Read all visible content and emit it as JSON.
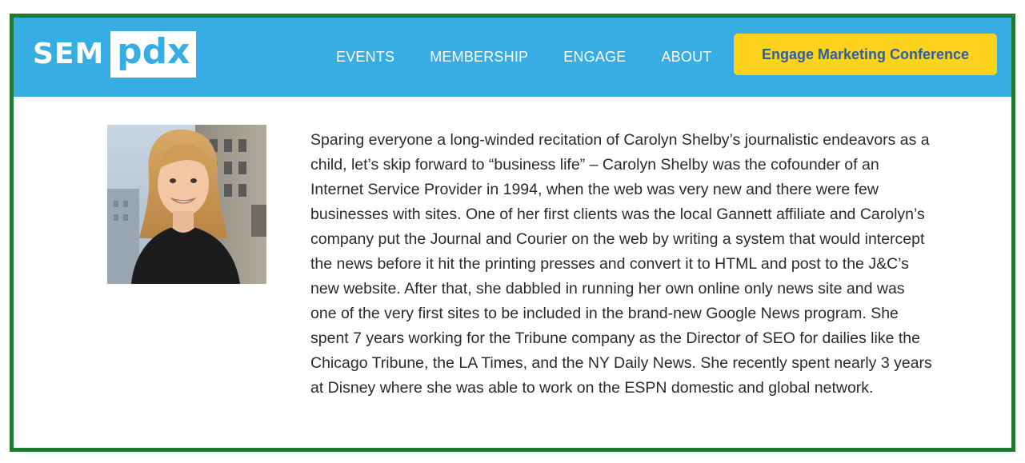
{
  "logo": {
    "sem": "SEM",
    "pdx": "pdx"
  },
  "nav": {
    "items": [
      {
        "label": "EVENTS"
      },
      {
        "label": "MEMBERSHIP"
      },
      {
        "label": "ENGAGE"
      },
      {
        "label": "ABOUT"
      }
    ],
    "cta_label": "Engage Marketing Conference"
  },
  "colors": {
    "header_bg": "#38ade3",
    "cta_bg": "#fcd21c",
    "cta_text": "#2b5ea6",
    "frame_border": "#1f7a2e"
  },
  "bio": {
    "text": "Sparing everyone a long-winded recitation of Carolyn Shelby’s journalistic endeavors as a child, let’s skip forward to “business life” – Carolyn Shelby was the cofounder of an Internet Service Provider in 1994, when the web was very new and there were few businesses with sites. One of her first clients was the local Gannett affiliate and Carolyn’s company put the Journal and Courier on the web by writing a system that would intercept the news before it hit the printing presses and convert it to HTML and post to the J&C’s new website. After that, she dabbled in running her own online only news site and was one of the very first sites to be included in the brand-new Google News program. She spent 7 years working for the Tribune company as the Director of SEO for dailies like the Chicago Tribune, the LA Times, and the NY Daily News. She recently spent nearly 3 years at Disney where she was able to work on the ESPN domestic and global network."
  }
}
